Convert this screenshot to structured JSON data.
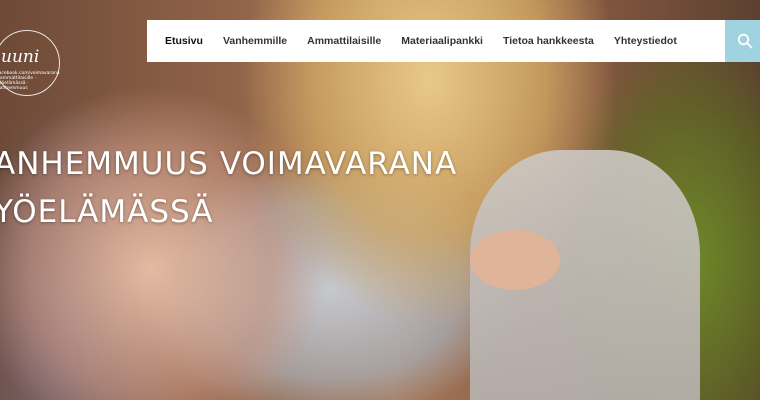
{
  "nav": {
    "items": [
      {
        "label": "Etusivu",
        "name": "nav-etusivu"
      },
      {
        "label": "Vanhemmille",
        "name": "nav-vanhemmille"
      },
      {
        "label": "Ammattilaisille",
        "name": "nav-ammattilaisille"
      },
      {
        "label": "Materiaalipankki",
        "name": "nav-materiaalipankki"
      },
      {
        "label": "Tietoa hankkeesta",
        "name": "nav-tietoa-hankkeesta"
      },
      {
        "label": "Yhteystiedot",
        "name": "nav-yhteystiedot"
      }
    ],
    "active_index": 0
  },
  "search": {
    "icon": "search-icon",
    "background": "#9fd3e2"
  },
  "logo": {
    "text": "uuni",
    "tagline": "facebook.com/voimavarana · ammattilaisille · työelämässä · vanhemmuus"
  },
  "hero": {
    "headline_line1": "ANHEMMUUS VOIMAVARANA",
    "headline_line2": "YÖELÄMÄSSÄ"
  },
  "colors": {
    "nav_bg": "#ffffff",
    "nav_text": "#333333",
    "headline": "#ffffff"
  }
}
